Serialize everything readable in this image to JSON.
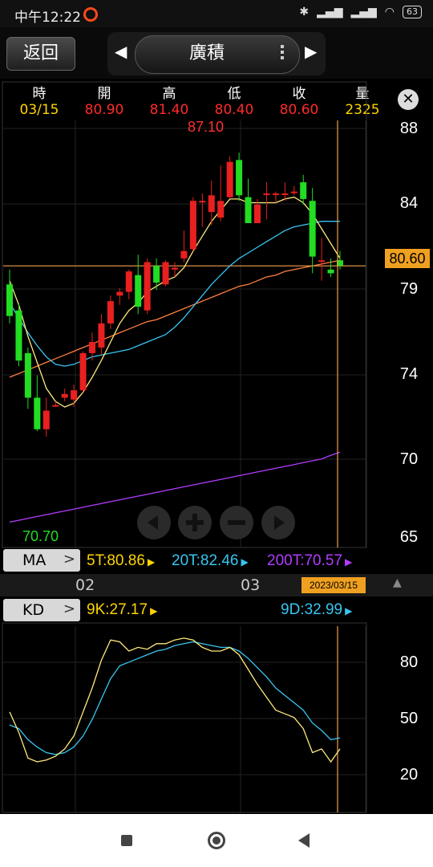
{
  "status_bar": {
    "time": "中午12:22",
    "battery": "63"
  },
  "top_bar": {
    "back_label": "返回",
    "title": "廣積"
  },
  "header": {
    "labels": [
      "時",
      "開",
      "高",
      "低",
      "收",
      "量"
    ],
    "values": [
      "03/15",
      "80.90",
      "81.40",
      "80.40",
      "80.60",
      "2325"
    ],
    "value_colors": [
      "#ffd400",
      "#ff2a2a",
      "#ff2a2a",
      "#ff2a2a",
      "#ff2a2a",
      "#ffd400"
    ]
  },
  "price_axis": {
    "ticks": [
      "88",
      "84",
      "79",
      "74",
      "70",
      "65"
    ],
    "current_price": "80.60"
  },
  "annotations": {
    "high_label": "87.10",
    "low_label": "70.70"
  },
  "ma_panel": {
    "button_label": "MA",
    "ma5": "5T:80.86",
    "ma20": "20T:82.46",
    "ma200": "200T:70.57",
    "colors": {
      "ma5": "#ffd400",
      "ma20": "#39c5f0",
      "ma200": "#b23cff"
    }
  },
  "date_bar": {
    "month_02": "02",
    "month_03": "03",
    "selected_date": "2023/03/15"
  },
  "kd_panel": {
    "button_label": "KD",
    "k_value": "9K:27.17",
    "d_value": "9D:32.99",
    "ticks": [
      "80",
      "50",
      "20"
    ]
  },
  "colors": {
    "up": "#e8201f",
    "down": "#22dd22",
    "crosshair": "#f0a050",
    "grid": "#222222"
  },
  "chart_data": {
    "type": "candlestick",
    "price_ylim": [
      65,
      88
    ],
    "ohlc_note": "open, high, low, close per day; last candle is 03/15",
    "candles": [
      [
        79.6,
        80.4,
        77.5,
        77.9
      ],
      [
        78.2,
        78.6,
        75.2,
        75.5
      ],
      [
        75.9,
        76.2,
        72.9,
        73.5
      ],
      [
        73.5,
        74.7,
        71.7,
        71.8
      ],
      [
        71.8,
        73.5,
        71.4,
        72.8
      ],
      [
        73.1,
        73.3,
        73.0,
        73.1
      ],
      [
        73.5,
        74.0,
        73.3,
        73.7
      ],
      [
        73.4,
        74.2,
        73.0,
        73.9
      ],
      [
        73.9,
        76.0,
        73.8,
        75.9
      ],
      [
        75.9,
        77.0,
        75.5,
        76.5
      ],
      [
        76.2,
        78.0,
        75.8,
        77.5
      ],
      [
        77.5,
        79.0,
        77.2,
        78.7
      ],
      [
        79.0,
        79.4,
        78.5,
        79.2
      ],
      [
        79.2,
        80.4,
        78.8,
        80.3
      ],
      [
        80.1,
        81.2,
        78.0,
        78.4
      ],
      [
        78.2,
        81.0,
        78.0,
        80.8
      ],
      [
        80.6,
        81.0,
        79.3,
        79.7
      ],
      [
        79.6,
        80.9,
        79.5,
        80.8
      ],
      [
        80.4,
        80.8,
        80.0,
        80.5
      ],
      [
        81.0,
        82.5,
        80.8,
        81.4
      ],
      [
        81.5,
        84.3,
        81.4,
        84.1
      ],
      [
        84.1,
        84.5,
        82.7,
        84.1
      ],
      [
        83.5,
        85.2,
        82.8,
        84.4
      ],
      [
        83.2,
        86.0,
        83.0,
        84.1
      ],
      [
        84.3,
        86.5,
        84.2,
        86.2
      ],
      [
        86.3,
        86.7,
        84.1,
        84.4
      ],
      [
        84.3,
        85.3,
        82.9,
        82.9
      ],
      [
        82.9,
        84.2,
        82.9,
        83.9
      ],
      [
        84.5,
        85.1,
        83.1,
        84.5
      ],
      [
        84.5,
        84.6,
        84.0,
        84.5
      ],
      [
        84.5,
        85.1,
        84.1,
        84.5
      ],
      [
        84.6,
        84.9,
        84.4,
        84.6
      ],
      [
        85.1,
        85.5,
        83.9,
        84.2
      ],
      [
        84.1,
        84.8,
        80.2,
        81.1
      ],
      [
        80.9,
        82.1,
        79.8,
        80.9
      ],
      [
        80.4,
        81.0,
        80.0,
        80.2
      ],
      [
        80.9,
        81.4,
        80.4,
        80.6
      ]
    ],
    "ma5": [
      79.8,
      78.5,
      76.8,
      75.4,
      74.0,
      73.3,
      73.0,
      73.2,
      73.8,
      74.6,
      75.5,
      76.5,
      77.5,
      78.2,
      78.6,
      79.2,
      79.5,
      79.8,
      80.0,
      80.5,
      81.4,
      82.2,
      83.0,
      83.6,
      84.2,
      84.2,
      84.0,
      84.0,
      84.0,
      84.0,
      84.2,
      84.3,
      84.0,
      83.4,
      82.6,
      81.8,
      81.0
    ],
    "ma20": [
      78.6,
      77.8,
      77.0,
      76.3,
      75.7,
      75.3,
      75.2,
      75.3,
      75.5,
      75.7,
      75.8,
      75.9,
      76.0,
      76.1,
      76.3,
      76.5,
      76.7,
      76.9,
      77.3,
      77.8,
      78.4,
      79.0,
      79.6,
      80.1,
      80.6,
      81.0,
      81.3,
      81.6,
      81.9,
      82.2,
      82.5,
      82.7,
      82.8,
      82.9,
      83.0,
      83.0,
      83.0
    ],
    "ma_long": [
      74.6,
      74.8,
      75.0,
      75.2,
      75.4,
      75.6,
      75.8,
      76.0,
      76.2,
      76.4,
      76.6,
      76.8,
      77.0,
      77.2,
      77.4,
      77.6,
      77.7,
      77.9,
      78.1,
      78.3,
      78.5,
      78.7,
      78.9,
      79.1,
      79.3,
      79.5,
      79.6,
      79.8,
      80.0,
      80.1,
      80.3,
      80.4,
      80.5,
      80.6,
      80.7,
      80.8,
      80.9
    ],
    "ma200": [
      66.8,
      66.9,
      67.0,
      67.1,
      67.2,
      67.3,
      67.4,
      67.5,
      67.6,
      67.7,
      67.8,
      67.9,
      68.0,
      68.1,
      68.2,
      68.3,
      68.4,
      68.5,
      68.6,
      68.7,
      68.8,
      68.9,
      69.0,
      69.1,
      69.2,
      69.3,
      69.4,
      69.5,
      69.6,
      69.7,
      69.8,
      69.9,
      70.0,
      70.1,
      70.2,
      70.4,
      70.57
    ],
    "kd_ylim": [
      0,
      100
    ],
    "k": [
      47,
      36,
      22,
      20,
      21,
      23,
      27,
      34,
      47,
      60,
      75,
      86,
      85,
      80,
      82,
      81,
      84,
      84,
      86,
      87,
      86,
      82,
      80,
      80,
      82,
      78,
      70,
      62,
      55,
      48,
      46,
      44,
      38,
      25,
      27,
      20,
      27
    ],
    "d": [
      40,
      38,
      32,
      28,
      25,
      24,
      25,
      28,
      34,
      43,
      54,
      65,
      72,
      74,
      76,
      78,
      80,
      81,
      83,
      84,
      85,
      84,
      83,
      82,
      82,
      80,
      76,
      71,
      66,
      60,
      56,
      52,
      48,
      41,
      37,
      32,
      33
    ]
  }
}
